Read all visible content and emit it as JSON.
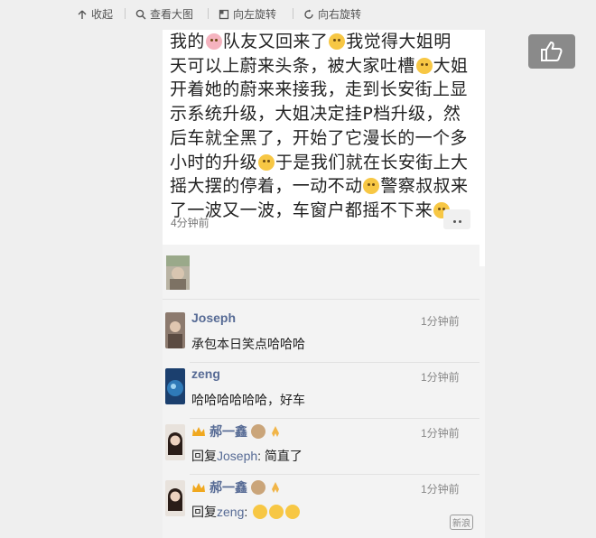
{
  "toolbar": {
    "collapse": "收起",
    "view_large": "查看大图",
    "rotate_left": "向左旋转",
    "rotate_right": "向右旋转"
  },
  "post": {
    "line1a": "我的",
    "line1b": "队友又回来了",
    "line1c": "我觉得大姐明",
    "line2": "天可以上蔚来头条，被大家吐槽",
    "line2b": "大姐",
    "line3": "开着她的蔚来来接我，走到长安街上显",
    "line4": "示系统升级，大姐决定挂P档升级，然",
    "line5": "后车就全黑了，开始了它漫长的一个多",
    "line6a": "小时的升级",
    "line6b": "于是我们就在长安街上大",
    "line7a": "摇大摆的停着，一动不动",
    "line7b": "警察叔叔来",
    "line8": "了一波又一波，车窗户都摇不下来",
    "time": "4分钟前"
  },
  "comments": [
    {
      "name": "Joseph",
      "text": "承包本日笑点哈哈哈",
      "time": "1分钟前"
    },
    {
      "name": "zeng",
      "text": "哈哈哈哈哈哈，好车",
      "time": "1分钟前"
    },
    {
      "name": "郝一鑫",
      "reply_prefix": "回复",
      "reply_to": "Joseph",
      "reply_text": ": 简直了",
      "time": "1分钟前"
    },
    {
      "name": "郝一鑫",
      "reply_prefix": "回复",
      "reply_to": "zeng",
      "reply_text": ":",
      "time": "1分钟前"
    }
  ],
  "watermark": {
    "text": "新浪"
  },
  "colors": {
    "name_blue": "#576b95",
    "like_button_bg": "#8a8a8a",
    "background": "#efefef"
  },
  "icons": [
    "collapse-icon",
    "zoom-icon",
    "rotate-left-icon",
    "rotate-right-icon",
    "thumbs-up-icon",
    "more-icon"
  ]
}
